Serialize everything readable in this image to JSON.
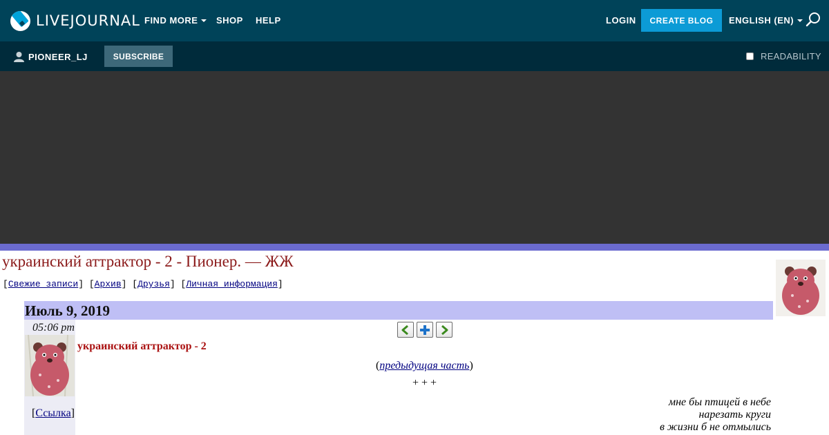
{
  "header": {
    "logo_text": "LIVEJOURNAL",
    "nav": {
      "find_more": "FIND MORE",
      "shop": "SHOP",
      "help": "HELP",
      "login": "LOGIN",
      "create_blog": "CREATE BLOG",
      "language": "ENGLISH (EN)"
    }
  },
  "userbar": {
    "username": "PIONEER_LJ",
    "subscribe_label": "SUBSCRIBE",
    "readability_label": "READABILITY",
    "readability_checked": false
  },
  "journal": {
    "title": "украинский аттрактор - 2 - Пионер. — ЖЖ",
    "nav_links": [
      "Свежие записи",
      "Архив",
      "Друзья",
      "Личная информация"
    ]
  },
  "entry": {
    "date": "Июль 9, 2019",
    "time": "05:06 pm",
    "link_label": "Ссылка",
    "title": "украинский аттрактор - 2",
    "prev_part_label": "предыдущая часть",
    "separator": "+ + +",
    "poem_lines": [
      "мне бы птицей в небе",
      "нарезать круги",
      "в жизни б не отмылись"
    ]
  },
  "colors": {
    "topbar": "#004359",
    "userbar": "#002b3b",
    "accent_button": "#0c9bd6",
    "banner": "#333333",
    "date_bar": "#bfbff5",
    "title_red": "#8b1a1a"
  },
  "icons": {
    "prev_entry": "arrow-left-icon",
    "add_memory": "plus-icon",
    "next_entry": "arrow-right-icon",
    "search": "search-icon",
    "user": "user-icon"
  }
}
